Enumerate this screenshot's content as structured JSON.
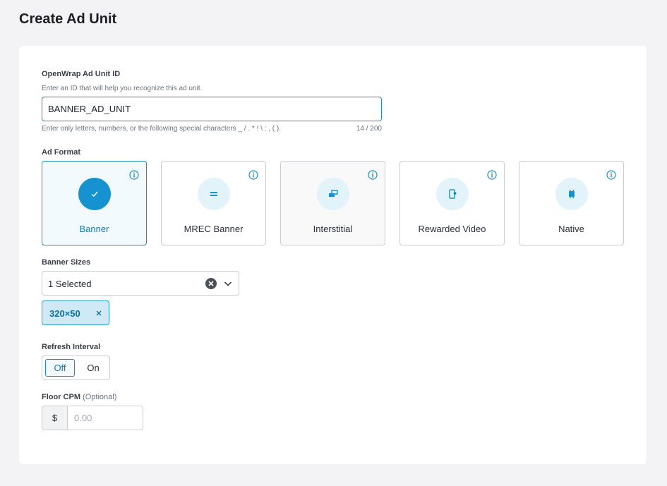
{
  "page": {
    "title": "Create Ad Unit"
  },
  "ad_unit_id": {
    "label": "OpenWrap Ad Unit ID",
    "description": "Enter an ID that will help you recognize this ad unit.",
    "value": "BANNER_AD_UNIT",
    "hint": "Enter only letters, numbers, or the following special characters _ / . * ! \\ : , ( ).",
    "counter": "14 / 200"
  },
  "ad_format": {
    "label": "Ad Format",
    "options": [
      {
        "name": "Banner",
        "icon": "check-icon",
        "selected": true
      },
      {
        "name": "MREC Banner",
        "icon": "mrec-banner-icon",
        "selected": false
      },
      {
        "name": "Interstitial",
        "icon": "interstitial-icon",
        "selected": false
      },
      {
        "name": "Rewarded Video",
        "icon": "rewarded-video-icon",
        "selected": false
      },
      {
        "name": "Native",
        "icon": "native-icon",
        "selected": false
      }
    ]
  },
  "banner_sizes": {
    "label": "Banner Sizes",
    "selected_text": "1 Selected",
    "chips": [
      "320×50"
    ]
  },
  "refresh_interval": {
    "label": "Refresh Interval",
    "off_label": "Off",
    "on_label": "On",
    "value": "Off"
  },
  "floor_cpm": {
    "label": "Floor CPM",
    "optional_text": "(Optional)",
    "currency": "$",
    "placeholder": "0.00"
  },
  "colors": {
    "accent": "#1592cf",
    "accent_border": "#1a8fbf",
    "chip_bg": "#cfeaf6",
    "icon_circle": "#e3f3fa",
    "page_bg": "#f3f3f5"
  }
}
